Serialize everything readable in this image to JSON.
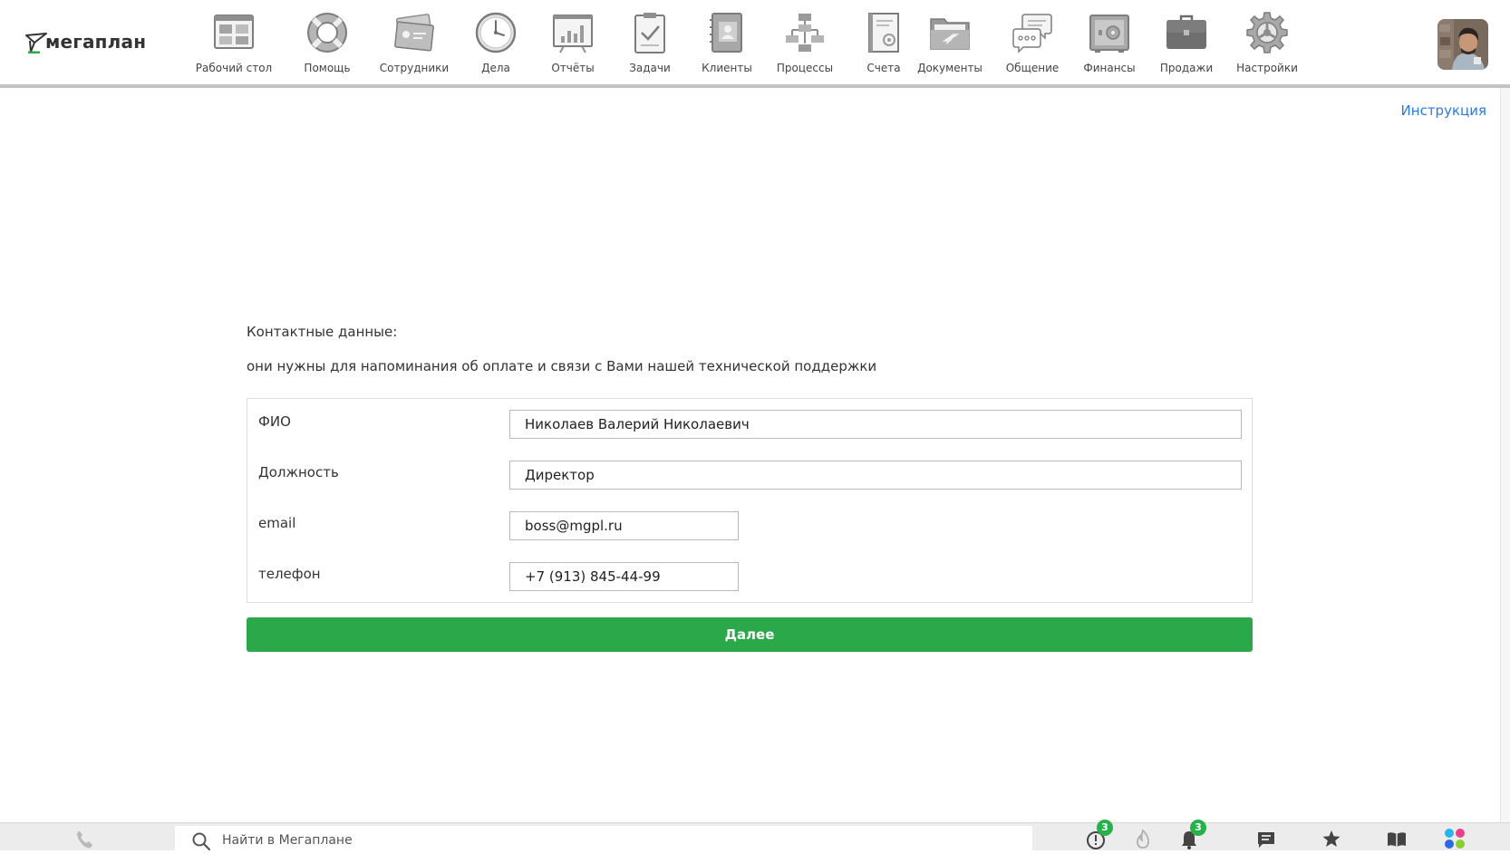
{
  "header": {
    "logo_text": "мегаплан",
    "nav": [
      {
        "label": "Рабочий стол",
        "icon": "desktop-icon"
      },
      {
        "label": "Помощь",
        "icon": "lifebuoy-icon"
      },
      {
        "label": "Сотрудники",
        "icon": "employee-cards-icon"
      },
      {
        "label": "Дела",
        "icon": "clock-icon"
      },
      {
        "label": "Отчёты",
        "icon": "report-chart-icon"
      },
      {
        "label": "Задачи",
        "icon": "clipboard-check-icon"
      },
      {
        "label": "Клиенты",
        "icon": "contacts-book-icon"
      },
      {
        "label": "Процессы",
        "icon": "process-flow-icon"
      },
      {
        "label": "Счета",
        "icon": "invoice-icon"
      },
      {
        "label": "Документы",
        "icon": "folder-icon"
      },
      {
        "label": "Общение",
        "icon": "chat-bubbles-icon"
      },
      {
        "label": "Финансы",
        "icon": "safe-icon"
      },
      {
        "label": "Продажи",
        "icon": "briefcase-icon"
      },
      {
        "label": "Настройки",
        "icon": "gear-icon"
      }
    ]
  },
  "help_link": "Инструкция",
  "form": {
    "heading": "Контактные данные:",
    "subheading": "они нужны для напоминания об оплате и связи с Вами нашей технической поддержки",
    "fields": {
      "name": {
        "label": "ФИО",
        "value": "Николаев Валерий Николаевич"
      },
      "position": {
        "label": "Должность",
        "value": "Директор"
      },
      "email": {
        "label": "email",
        "value": "boss@mgpl.ru"
      },
      "phone": {
        "label": "телефон",
        "value": "+7 (913) 845-44-99"
      }
    },
    "submit_label": "Далее"
  },
  "bottom_bar": {
    "search_placeholder": "Найти в Мегаплане",
    "alerts_count": "3",
    "notifications_count": "3"
  },
  "colors": {
    "accent_green": "#2ba84a",
    "link_blue": "#2a7ae2",
    "badge_green": "#26b14a",
    "icon_gray": "#8e8e8e"
  }
}
